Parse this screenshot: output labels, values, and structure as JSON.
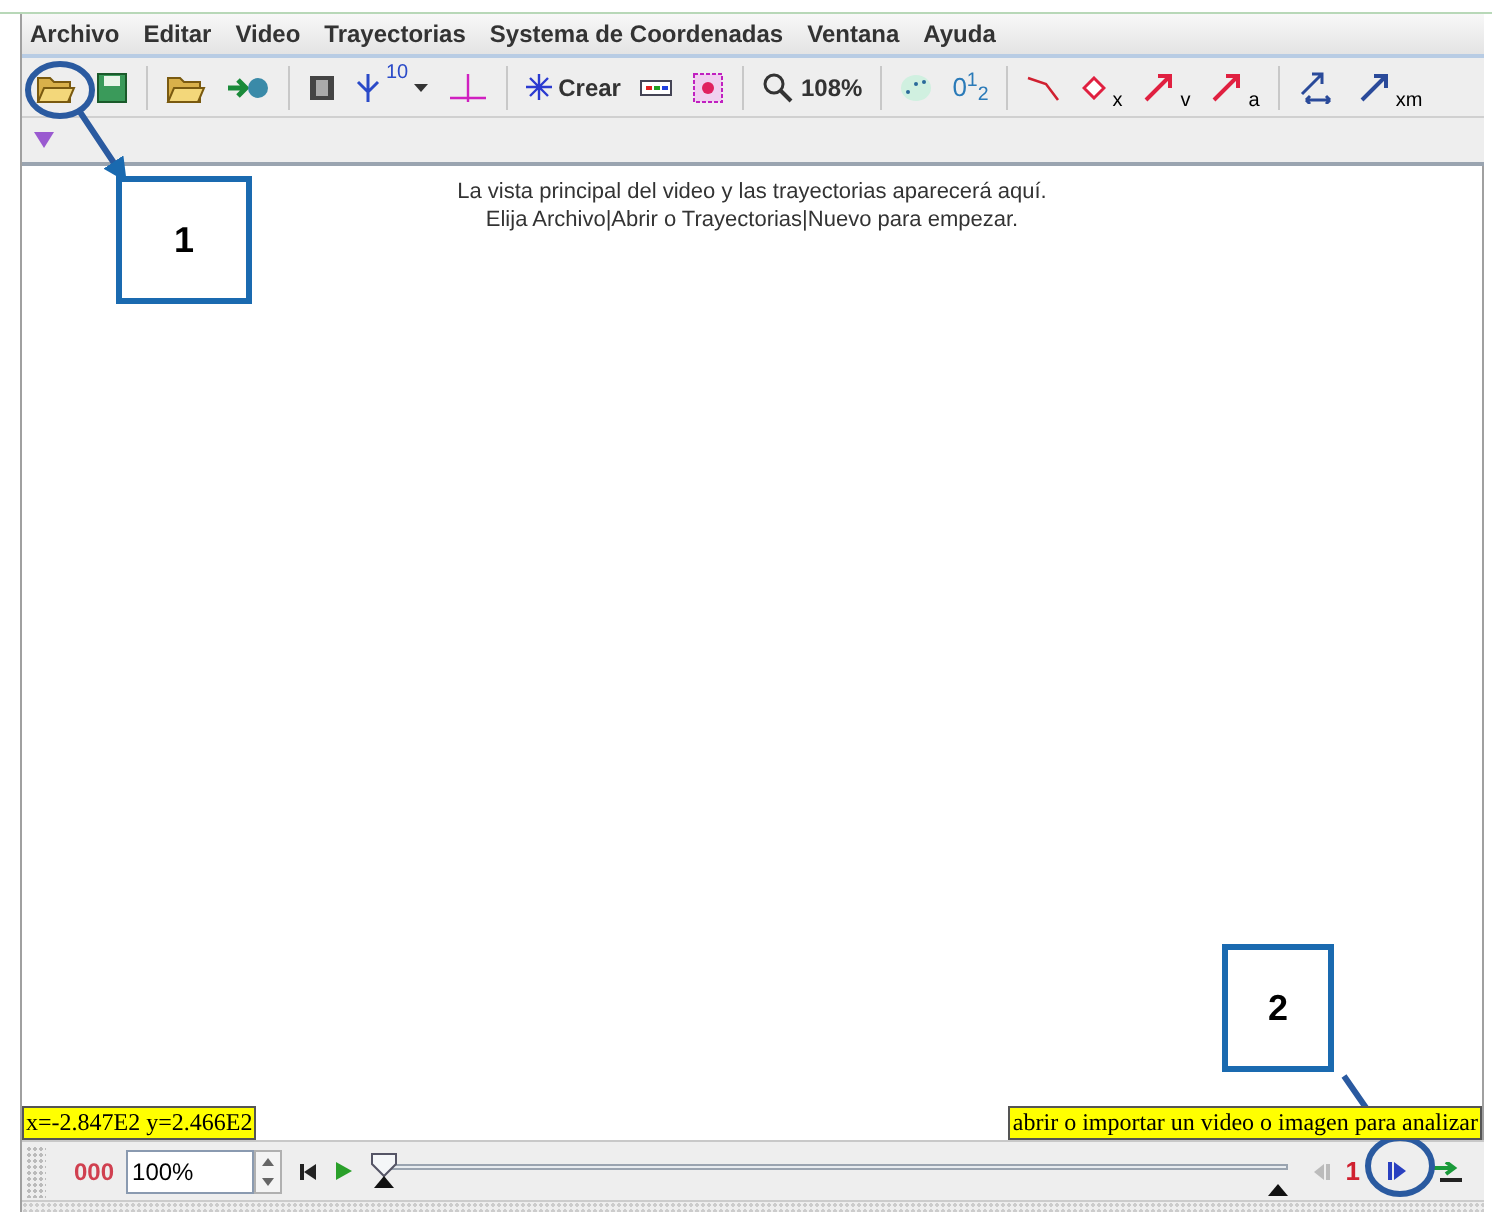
{
  "menu": [
    "Archivo",
    "Editar",
    "Video",
    "Trayectorias",
    "Systema de Coordenadas",
    "Ventana",
    "Ayuda"
  ],
  "toolbar": {
    "axis_sub": "10",
    "create": "Crear",
    "zoom": "108%",
    "sequence": "0$^{1}$$_{2}$",
    "position_sub": "x",
    "velocity_sub": "v",
    "acceleration_sub": "a",
    "mass_sub": "xm"
  },
  "view": {
    "message": [
      "La vista principal del video y las trayectorias aparecerá aquí.",
      "Elija Archivo|Abrir o Trayectorias|Nuevo para empezar."
    ],
    "coordinates": "x=-2.847E2  y=2.466E2",
    "hint": "abrir o importar un video o imagen para analizar"
  },
  "player": {
    "frame": "000",
    "rate": "100%",
    "slider": {
      "level": 0
    },
    "step": "1"
  },
  "callouts": [
    {
      "label": "1"
    },
    {
      "label": "2"
    }
  ]
}
